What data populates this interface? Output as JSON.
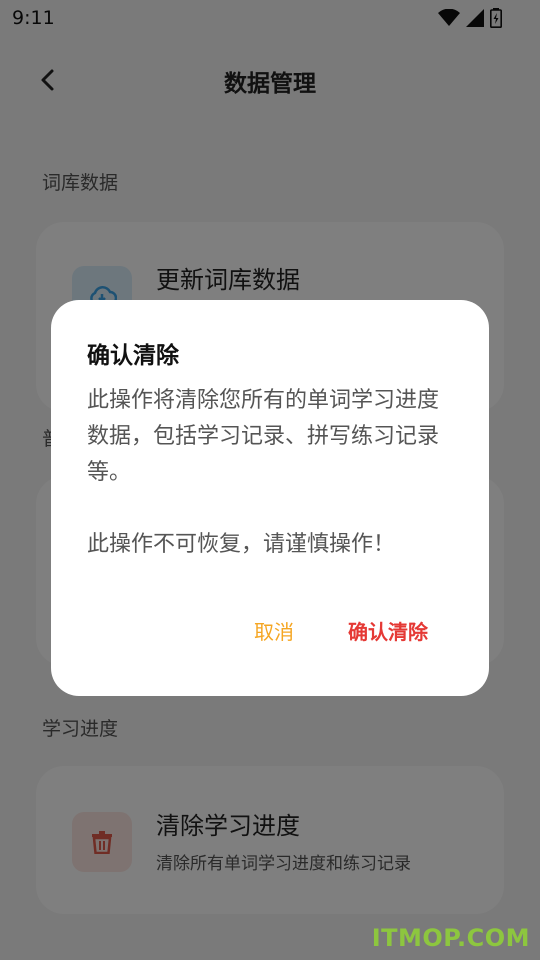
{
  "status_bar": {
    "time": "9:11"
  },
  "header": {
    "title": "数据管理"
  },
  "sections": {
    "library": {
      "title": "词库数据",
      "item": {
        "title": "更新词库数据"
      }
    },
    "hidden_section_initial": "普",
    "progress": {
      "title": "学习进度",
      "item": {
        "title": "清除学习进度",
        "subtitle": "清除所有单词学习进度和练习记录"
      }
    }
  },
  "dialog": {
    "title": "确认清除",
    "body_line1": "此操作将清除您所有的单词学习进度数据，包括学习记录、拼写练习记录等。",
    "body_line2": "此操作不可恢复，请谨慎操作！",
    "cancel_label": "取消",
    "confirm_label": "确认清除"
  },
  "watermark": "ITMOP.COM",
  "colors": {
    "cancel": "#f5a623",
    "confirm": "#e53935",
    "cloud_icon": "#3ba3e6",
    "trash_icon": "#e05b4b"
  }
}
